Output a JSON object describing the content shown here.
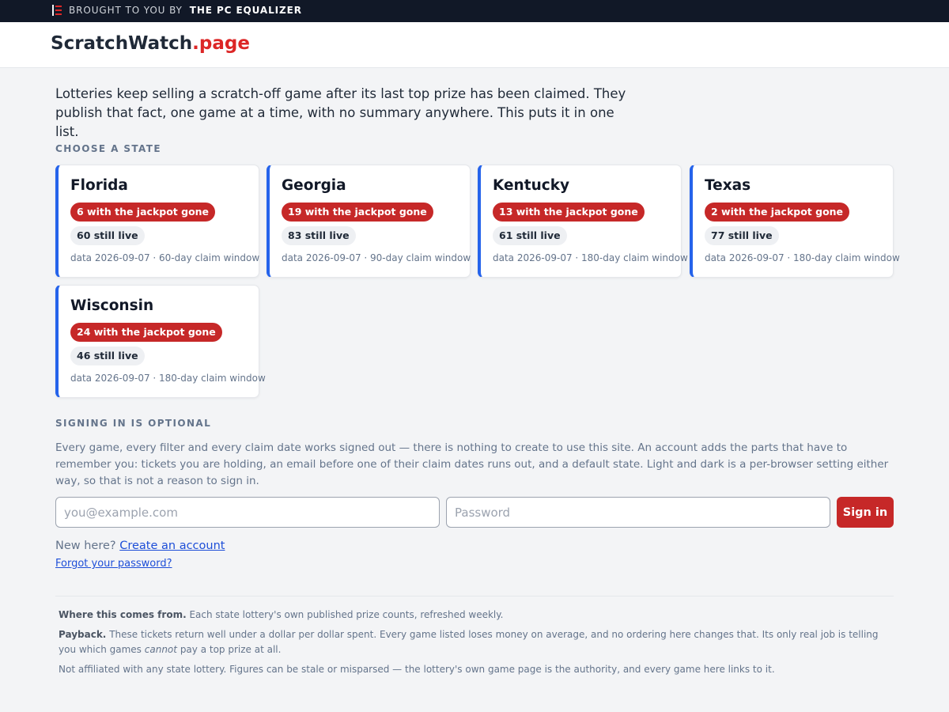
{
  "topbar": {
    "prefix": "BROUGHT TO YOU BY",
    "org": "THE PC EQUALIZER"
  },
  "brand": {
    "name": "ScratchWatch",
    "tld": ".page"
  },
  "intro": "Lotteries keep selling a scratch-off game after its last top prize has been claimed. They publish that fact, one game at a time, with no summary anywhere. This puts it in one list.",
  "states_heading": "CHOOSE A STATE",
  "states": [
    {
      "name": "Florida",
      "gone": "6 with the jackpot gone",
      "live": "60 still live",
      "meta": "data 2026-09-07 · 60-day claim window"
    },
    {
      "name": "Georgia",
      "gone": "19 with the jackpot gone",
      "live": "83 still live",
      "meta": "data 2026-09-07 · 90-day claim window"
    },
    {
      "name": "Kentucky",
      "gone": "13 with the jackpot gone",
      "live": "61 still live",
      "meta": "data 2026-09-07 · 180-day claim window"
    },
    {
      "name": "Texas",
      "gone": "2 with the jackpot gone",
      "live": "77 still live",
      "meta": "data 2026-09-07 · 180-day claim window"
    },
    {
      "name": "Wisconsin",
      "gone": "24 with the jackpot gone",
      "live": "46 still live",
      "meta": "data 2026-09-07 · 180-day claim window"
    }
  ],
  "signin": {
    "heading": "SIGNING IN IS OPTIONAL",
    "text": "Every game, every filter and every claim date works signed out — there is nothing to create to use this site. An account adds the parts that have to remember you: tickets you are holding, an email before one of their claim dates runs out, and a default state. Light and dark is a per-browser setting either way, so that is not a reason to sign in.",
    "email_placeholder": "you@example.com",
    "password_placeholder": "Password",
    "button": "Sign in",
    "new_here": "New here?",
    "create_link": "Create an account",
    "forgot_link": "Forgot your password?"
  },
  "footer": {
    "source_label": "Where this comes from.",
    "source_text": "Each state lottery's own published prize counts, refreshed weekly.",
    "payback_label": "Payback.",
    "payback_text_1": "These tickets return well under a dollar per dollar spent. Every game listed loses money on average, and no ordering here changes that. Its only real job is telling you which games",
    "payback_em": "cannot",
    "payback_text_2": "pay a top prize at all.",
    "disclaimer": "Not affiliated with any state lottery. Figures can be stale or misparsed — the lottery's own game page is the authority, and every game here links to it."
  },
  "colors": {
    "accent": "#2563eb",
    "danger": "#c62828",
    "brand_tld": "#dc2626",
    "topbar": "#111827"
  }
}
